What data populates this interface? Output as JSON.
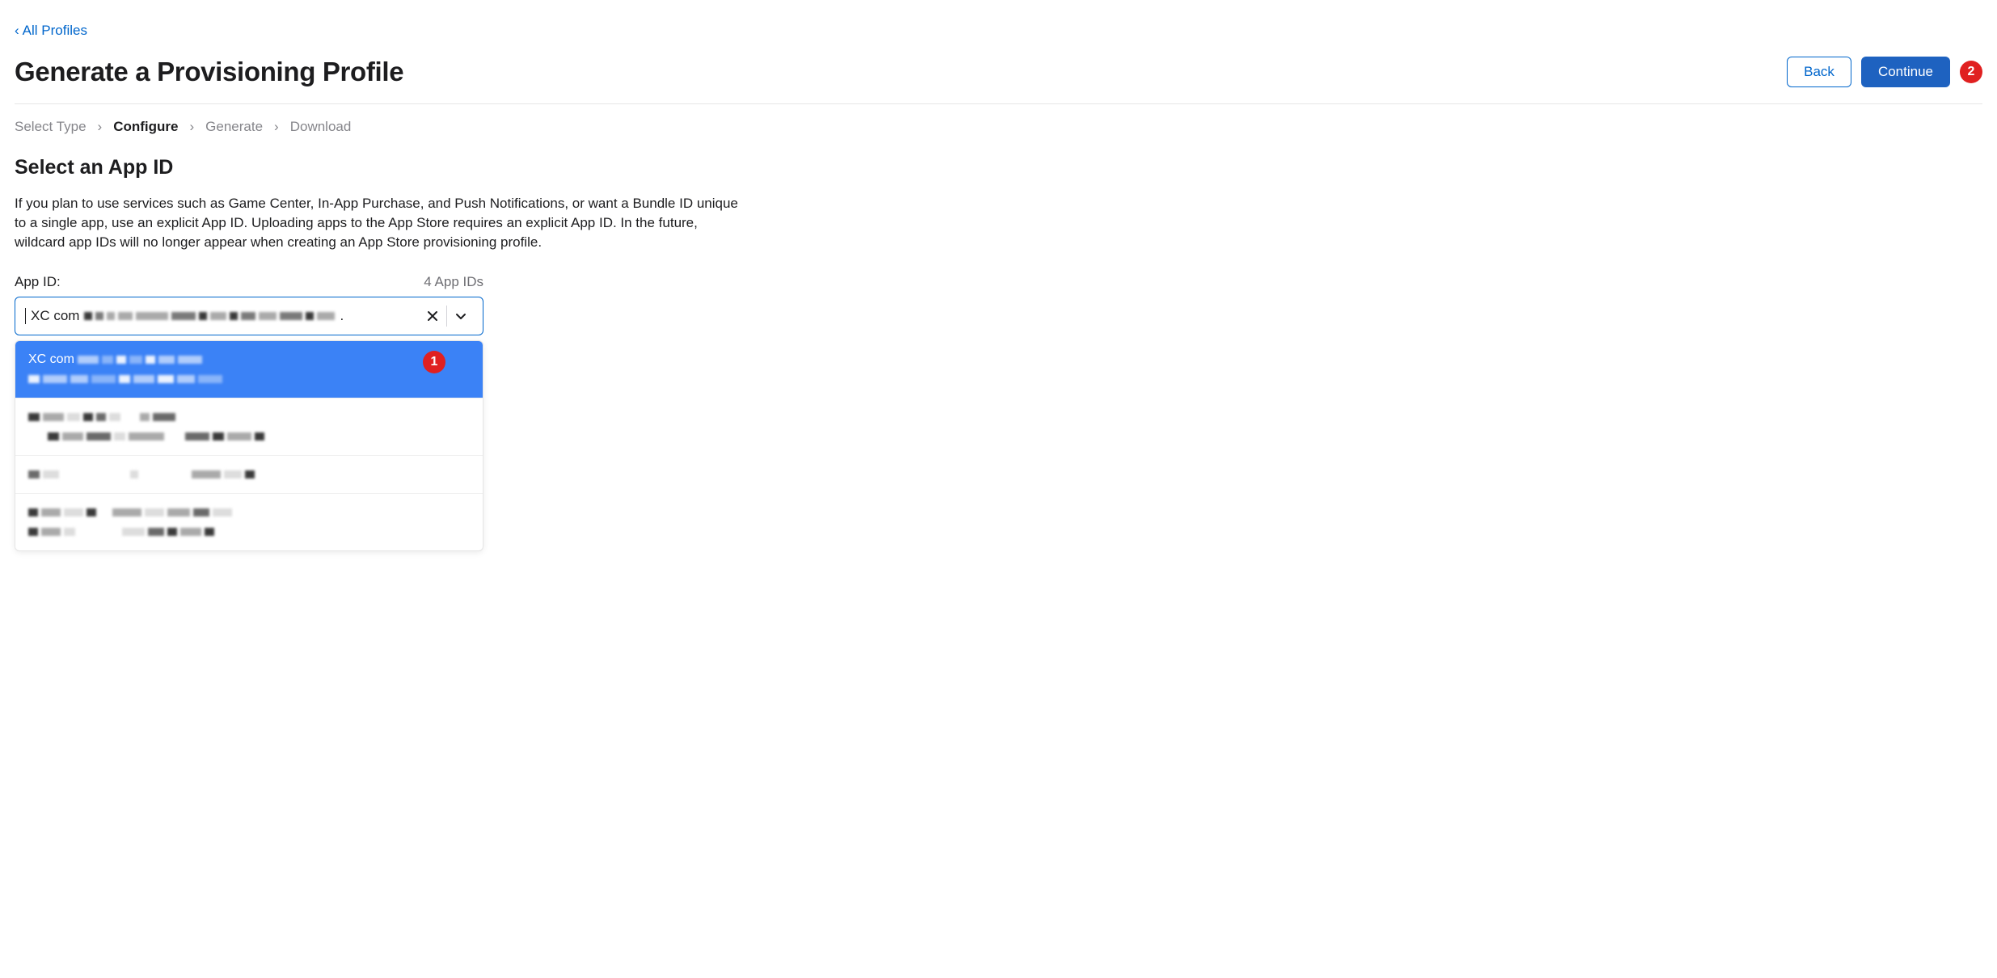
{
  "nav": {
    "back_link": "All Profiles"
  },
  "header": {
    "title": "Generate a Provisioning Profile",
    "back_btn": "Back",
    "continue_btn": "Continue"
  },
  "breadcrumb": {
    "items": [
      {
        "label": "Select Type",
        "active": false
      },
      {
        "label": "Configure",
        "active": true
      },
      {
        "label": "Generate",
        "active": false
      },
      {
        "label": "Download",
        "active": false
      }
    ]
  },
  "section": {
    "title": "Select an App ID",
    "desc": "If you plan to use services such as Game Center, In-App Purchase, and Push Notifications, or want a Bundle ID unique to a single app, use an explicit App ID. Uploading apps to the App Store requires an explicit App ID. In the future, wildcard app IDs will no longer appear when creating an App Store provisioning profile."
  },
  "field": {
    "label": "App ID:",
    "count": "4 App IDs",
    "input_prefix": "XC com",
    "input_trail": ".",
    "options": [
      {
        "prefix": "XC com",
        "selected": true
      },
      {
        "prefix": "",
        "selected": false
      },
      {
        "prefix": "",
        "selected": false
      },
      {
        "prefix": "",
        "selected": false
      }
    ]
  },
  "annotations": {
    "combo_badge": "1",
    "continue_badge": "2"
  }
}
